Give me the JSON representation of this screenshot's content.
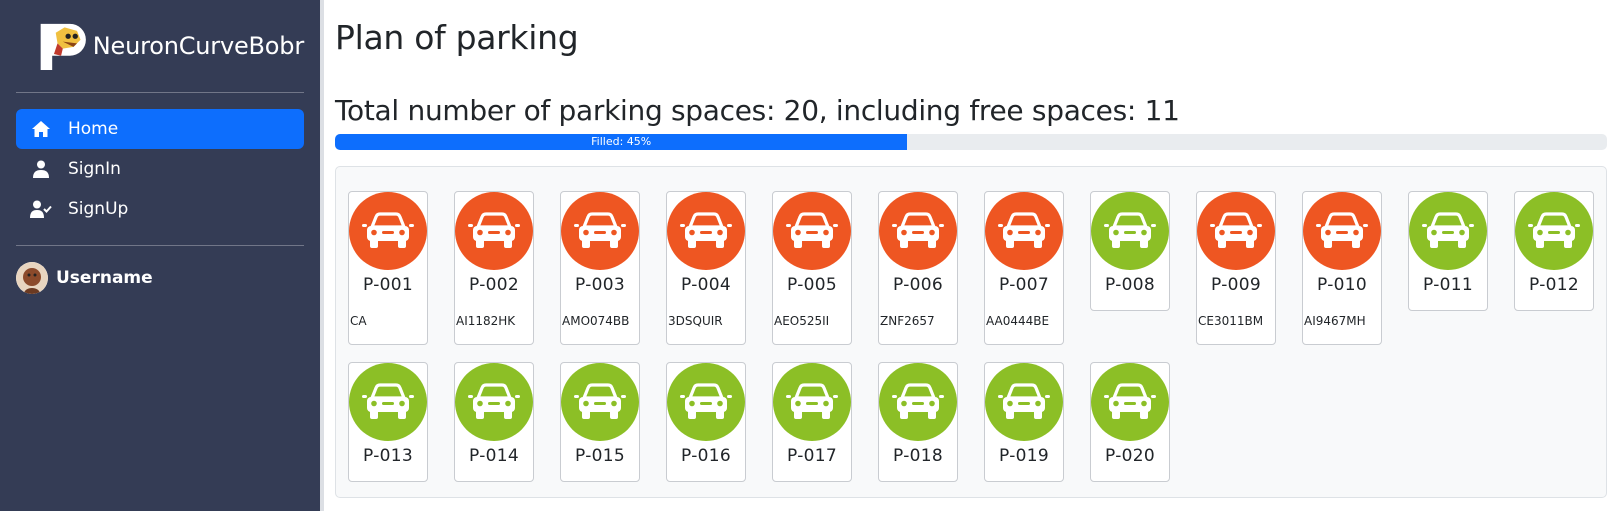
{
  "sidebar": {
    "brand": "NeuronCurveBobr",
    "nav": [
      {
        "label": "Home",
        "icon": "home-icon",
        "active": true
      },
      {
        "label": "SignIn",
        "icon": "user-icon",
        "active": false
      },
      {
        "label": "SignUp",
        "icon": "user-check-icon",
        "active": false
      }
    ],
    "user": {
      "name": "Username",
      "icon": "avatar"
    }
  },
  "main": {
    "title": "Plan of parking",
    "summary": "Total number of parking spaces: 20, including free spaces: 11",
    "progress": {
      "label": "Filled: 45%",
      "percent": 45
    }
  },
  "colors": {
    "occupied": "#ee5622",
    "free": "#8cbf26",
    "accent": "#0d6efd",
    "sidebar": "#343c55"
  },
  "spots": [
    {
      "id": "P-001",
      "status": "occupied",
      "plate": "CA"
    },
    {
      "id": "P-002",
      "status": "occupied",
      "plate": "AI1182HK"
    },
    {
      "id": "P-003",
      "status": "occupied",
      "plate": "AMO074BB"
    },
    {
      "id": "P-004",
      "status": "occupied",
      "plate": "3DSQUIR"
    },
    {
      "id": "P-005",
      "status": "occupied",
      "plate": "AEO525II"
    },
    {
      "id": "P-006",
      "status": "occupied",
      "plate": "ZNF2657"
    },
    {
      "id": "P-007",
      "status": "occupied",
      "plate": "AA0444BE"
    },
    {
      "id": "P-008",
      "status": "free",
      "plate": ""
    },
    {
      "id": "P-009",
      "status": "occupied",
      "plate": "CE3011BM"
    },
    {
      "id": "P-010",
      "status": "occupied",
      "plate": "AI9467MH"
    },
    {
      "id": "P-011",
      "status": "free",
      "plate": ""
    },
    {
      "id": "P-012",
      "status": "free",
      "plate": ""
    },
    {
      "id": "P-013",
      "status": "free",
      "plate": ""
    },
    {
      "id": "P-014",
      "status": "free",
      "plate": ""
    },
    {
      "id": "P-015",
      "status": "free",
      "plate": ""
    },
    {
      "id": "P-016",
      "status": "free",
      "plate": ""
    },
    {
      "id": "P-017",
      "status": "free",
      "plate": ""
    },
    {
      "id": "P-018",
      "status": "free",
      "plate": ""
    },
    {
      "id": "P-019",
      "status": "free",
      "plate": ""
    },
    {
      "id": "P-020",
      "status": "free",
      "plate": ""
    }
  ]
}
